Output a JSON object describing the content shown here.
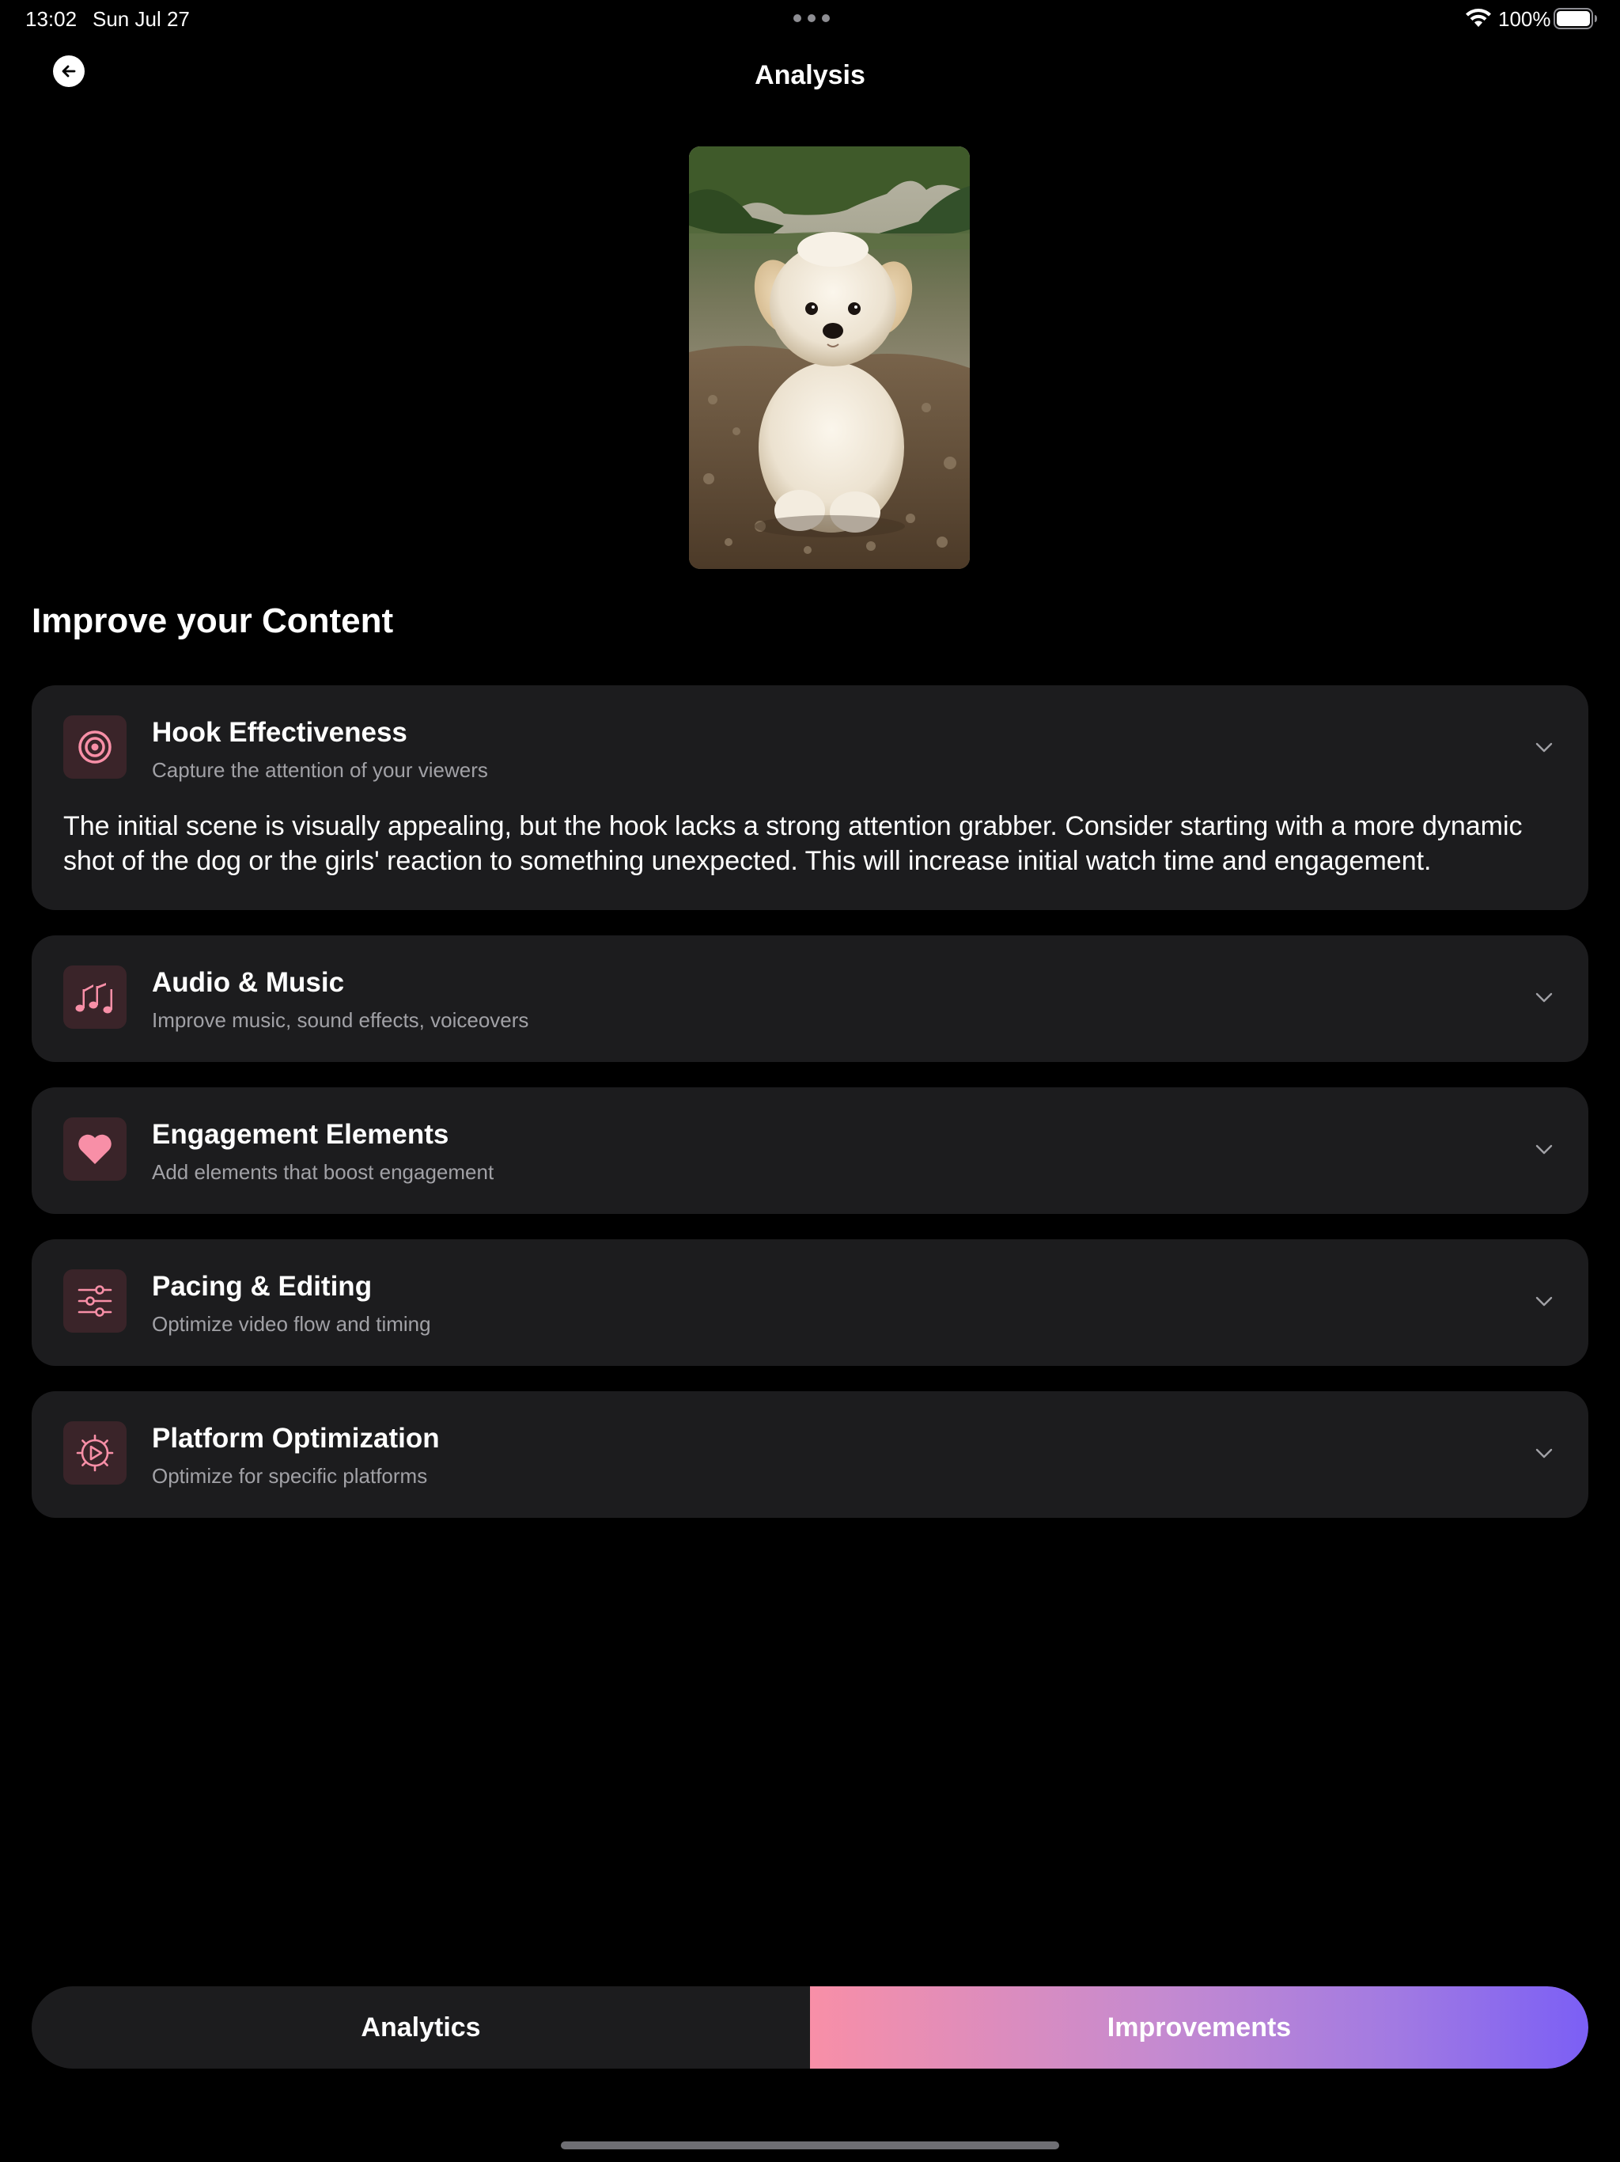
{
  "status_bar": {
    "time": "13:02",
    "date": "Sun Jul 27",
    "battery": "100%"
  },
  "header": {
    "title": "Analysis"
  },
  "section_title": "Improve your Content",
  "cards": [
    {
      "title": "Hook Effectiveness",
      "subtitle": "Capture the attention of your viewers",
      "icon": "target-icon",
      "expanded": true,
      "body": "The initial scene is visually appealing, but the hook lacks a strong attention grabber. Consider starting with a more dynamic shot of the dog or the girls' reaction to something unexpected. This will increase initial watch time and engagement."
    },
    {
      "title": "Audio & Music",
      "subtitle": "Improve music, sound effects, voiceovers",
      "icon": "music-notes-icon",
      "expanded": false
    },
    {
      "title": "Engagement Elements",
      "subtitle": "Add elements that boost engagement",
      "icon": "heart-icon",
      "expanded": false
    },
    {
      "title": "Pacing & Editing",
      "subtitle": "Optimize video flow and timing",
      "icon": "sliders-icon",
      "expanded": false
    },
    {
      "title": "Platform Optimization",
      "subtitle": "Optimize for specific platforms",
      "icon": "gear-play-icon",
      "expanded": false
    }
  ],
  "segments": {
    "analytics": "Analytics",
    "improvements": "Improvements",
    "selected": "improvements"
  },
  "colors": {
    "accent": "#f88fa7",
    "card_bg": "#1c1c1e",
    "icon_bg": "#3a2429",
    "gradient_start": "#f88fa7",
    "gradient_end": "#7b5ff5"
  }
}
